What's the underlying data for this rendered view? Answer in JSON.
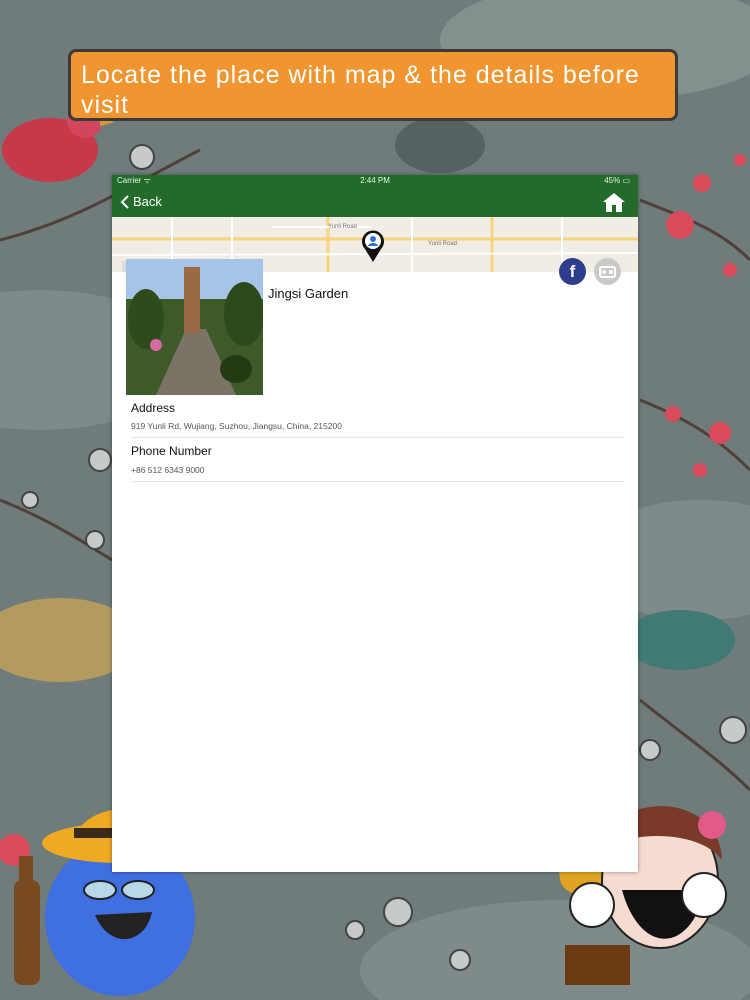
{
  "banner": {
    "text": "Locate the place with map & the details before visit"
  },
  "status_bar": {
    "carrier": "Carrier ᯤ",
    "time": "2:44 PM",
    "battery": "45% ▭"
  },
  "nav": {
    "back_label": "Back"
  },
  "map": {
    "road_label": "Yunli Road",
    "road_label_2": "Yunli Road"
  },
  "place": {
    "title": "Jingsi Garden"
  },
  "details": {
    "address_label": "Address",
    "address_value": "919 Yunli Rd, Wujiang, Suzhou, Jiangsu, China, 215200",
    "phone_label": "Phone Number",
    "phone_value": "+86 512 6343 9000"
  },
  "colors": {
    "nav_green": "#236b2b",
    "banner_orange": "#f0952f",
    "facebook_blue": "#2d3e8c"
  }
}
